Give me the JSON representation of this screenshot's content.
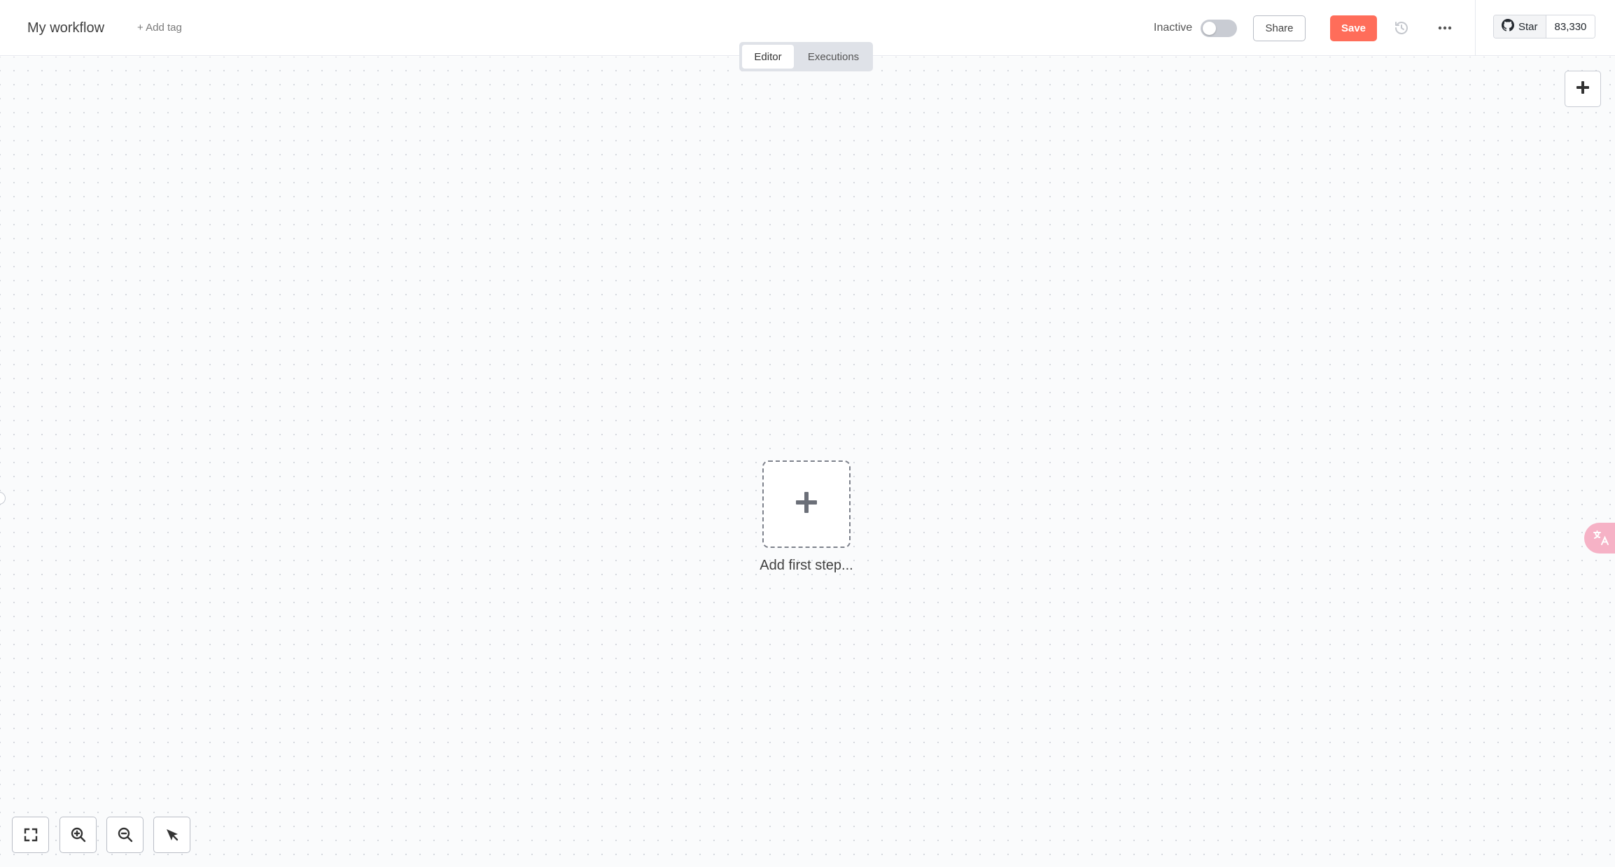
{
  "header": {
    "workflow_name": "My workflow",
    "add_tag": "+ Add tag",
    "status_label": "Inactive",
    "active": false,
    "share_label": "Share",
    "save_label": "Save",
    "github": {
      "star_label": "Star",
      "star_count": "83,330"
    }
  },
  "tabs": [
    {
      "label": "Editor",
      "active": true
    },
    {
      "label": "Executions",
      "active": false
    }
  ],
  "canvas": {
    "first_step_label": "Add first step..."
  },
  "colors": {
    "save": "#ff6d5a",
    "canvas_bg": "#fafbfc",
    "tabs_bg": "#dfe2e8",
    "translate_badge": "#f6b2c6"
  },
  "icons": {
    "history": "history-icon",
    "more": "more-horizontal-icon",
    "github": "github-icon",
    "add": "plus-icon",
    "fit_view": "fit-view-icon",
    "zoom_in": "zoom-in-icon",
    "zoom_out": "zoom-out-icon",
    "tidy": "pointer-icon",
    "translate": "translate-icon"
  }
}
